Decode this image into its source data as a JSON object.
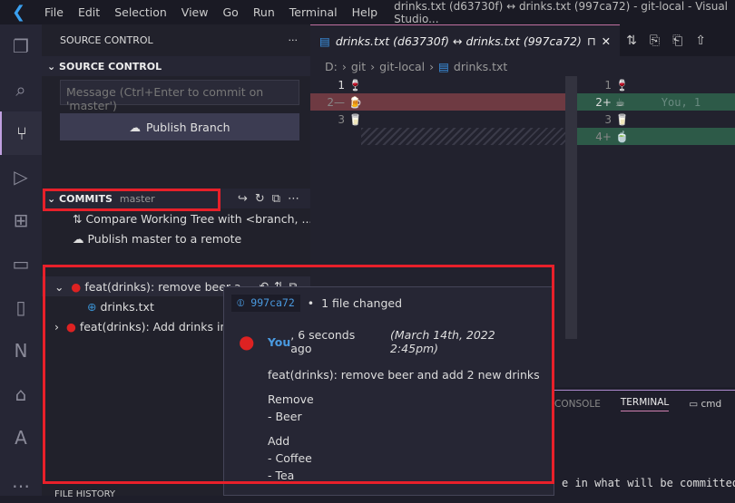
{
  "titlebar": {
    "menu": [
      "File",
      "Edit",
      "Selection",
      "View",
      "Go",
      "Run",
      "Terminal",
      "Help"
    ],
    "title": "drinks.txt (d63730f) ↔ drinks.txt (997ca72) - git-local - Visual Studio..."
  },
  "sidebar": {
    "header": "SOURCE CONTROL",
    "more": "···",
    "section": "SOURCE CONTROL",
    "message_placeholder": "Message (Ctrl+Enter to commit on 'master')",
    "publish_label": "Publish Branch",
    "commits": {
      "label": "COMMITS",
      "branch": "master",
      "actions": [
        "Compare Working Tree with <branch, ...",
        "Publish master to a remote"
      ],
      "items": [
        {
          "label": "feat(drinks): remove beer a...",
          "expanded": true,
          "files": [
            "drinks.txt"
          ]
        },
        {
          "label": "feat(drinks): Add drinks in",
          "expanded": false
        }
      ]
    },
    "file_history": "FILE HISTORY"
  },
  "editor": {
    "tab": "drinks.txt (d63730f) ↔ drinks.txt (997ca72)",
    "breadcrumb": [
      "D:",
      "git",
      "git-local",
      "drinks.txt"
    ],
    "left": [
      {
        "n": "1",
        "t": "🍷"
      },
      {
        "n": "2—",
        "t": "🍺",
        "type": "del"
      },
      {
        "n": "3",
        "t": "🥛"
      }
    ],
    "right": [
      {
        "n": "1",
        "t": "🍷"
      },
      {
        "n": "2+",
        "t": "☕",
        "type": "add",
        "blame": "You, 1"
      },
      {
        "n": "3",
        "t": "🥛"
      },
      {
        "n": "4+",
        "t": "🍵",
        "type": "add"
      }
    ]
  },
  "panel": {
    "tabs": [
      "CONSOLE",
      "TERMINAL"
    ],
    "active": "TERMINAL",
    "terminal": "cmd",
    "output": "e in what will be committed)"
  },
  "tooltip": {
    "sha": "997ca72",
    "files_changed": "1 file changed",
    "author": "You",
    "relative": ", 6 seconds ago",
    "date": "(March 14th, 2022 2:45pm)",
    "subject": "feat(drinks): remove beer and add 2 new drinks",
    "body": [
      "Remove",
      "- Beer",
      "",
      "Add",
      "- Coffee",
      "- Tea"
    ]
  },
  "colors": {
    "highlight_box": "#e8202a",
    "deleted": "#6e3a42",
    "added": "#2d5a48",
    "accent": "#3aa0f0"
  }
}
